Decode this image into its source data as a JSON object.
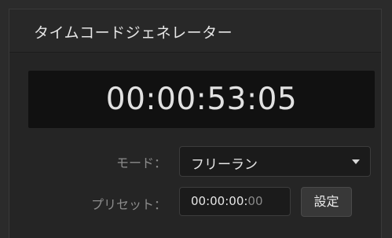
{
  "panel": {
    "title": "タイムコードジェネレーター"
  },
  "timecode_display": "00:00:53:05",
  "mode": {
    "label": "モード：",
    "value": "フリーラン"
  },
  "preset": {
    "label": "プリセット：",
    "value_main": "00:00:00:",
    "value_dim": "00",
    "button_label": "設定"
  }
}
